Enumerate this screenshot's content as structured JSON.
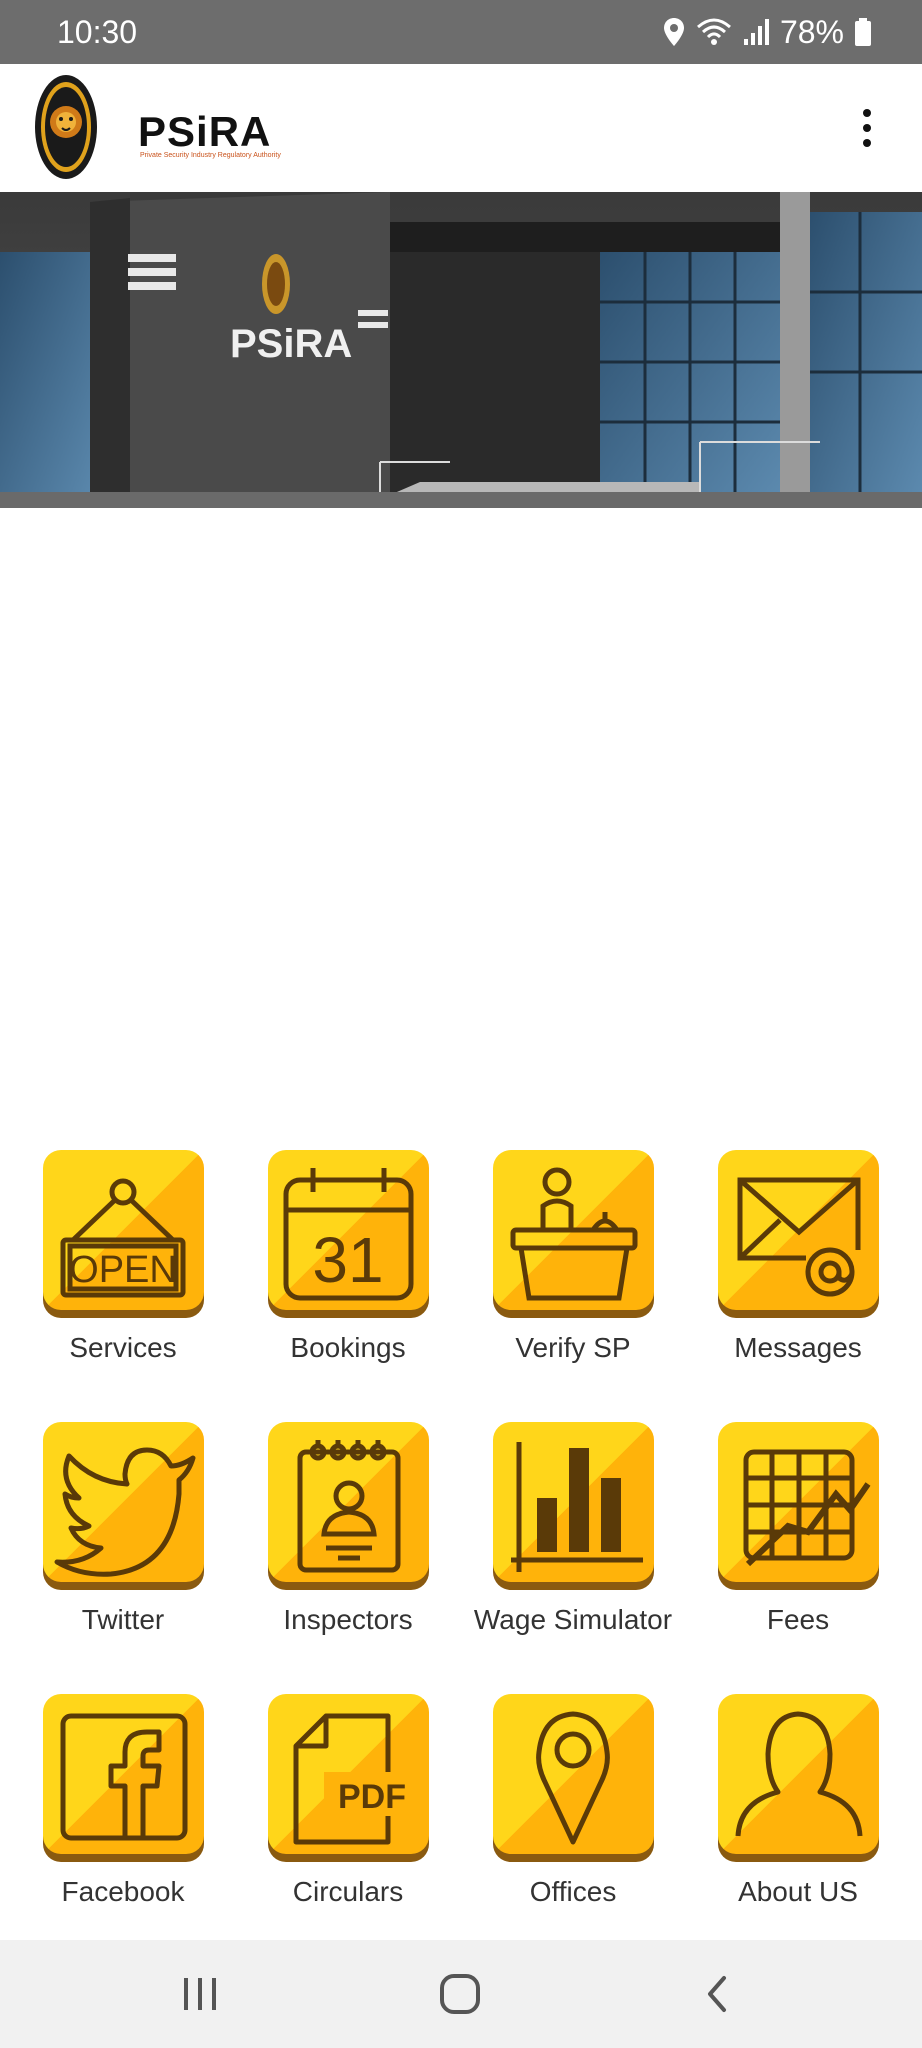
{
  "status_bar": {
    "time": "10:30",
    "battery": "78%",
    "icons": [
      "location-icon",
      "wifi-icon",
      "signal-icon",
      "battery-icon"
    ]
  },
  "app_bar": {
    "logo_text": "PSiRA",
    "logo_subtitle": "Private Security Industry Regulatory Authority",
    "menu_icon": "more-vert-icon"
  },
  "hero": {
    "sign_text": "PSiRA"
  },
  "colors": {
    "tile_light": "#ffd61a",
    "tile_dark": "#ffb30a",
    "icon_stroke": "#5a3a08",
    "status_bar": "#6d6d6d"
  },
  "tiles": [
    {
      "label": "Services",
      "icon": "open-sign-icon",
      "icon_text": "OPEN"
    },
    {
      "label": "Bookings",
      "icon": "calendar-icon",
      "icon_text": "31"
    },
    {
      "label": "Verify SP",
      "icon": "reception-desk-icon"
    },
    {
      "label": "Messages",
      "icon": "email-icon"
    },
    {
      "label": "Twitter",
      "icon": "twitter-bird-icon"
    },
    {
      "label": "Inspectors",
      "icon": "id-badge-icon"
    },
    {
      "label": "Wage Simulator",
      "icon": "bar-chart-icon"
    },
    {
      "label": "Fees",
      "icon": "graph-paper-icon"
    },
    {
      "label": "Facebook",
      "icon": "facebook-icon"
    },
    {
      "label": "Circulars",
      "icon": "pdf-document-icon",
      "icon_text": "PDF"
    },
    {
      "label": "Offices",
      "icon": "map-pin-icon"
    },
    {
      "label": "About US",
      "icon": "person-icon"
    }
  ],
  "nav_bar": {
    "icons": [
      "recent-apps-icon",
      "home-icon",
      "back-icon"
    ]
  }
}
